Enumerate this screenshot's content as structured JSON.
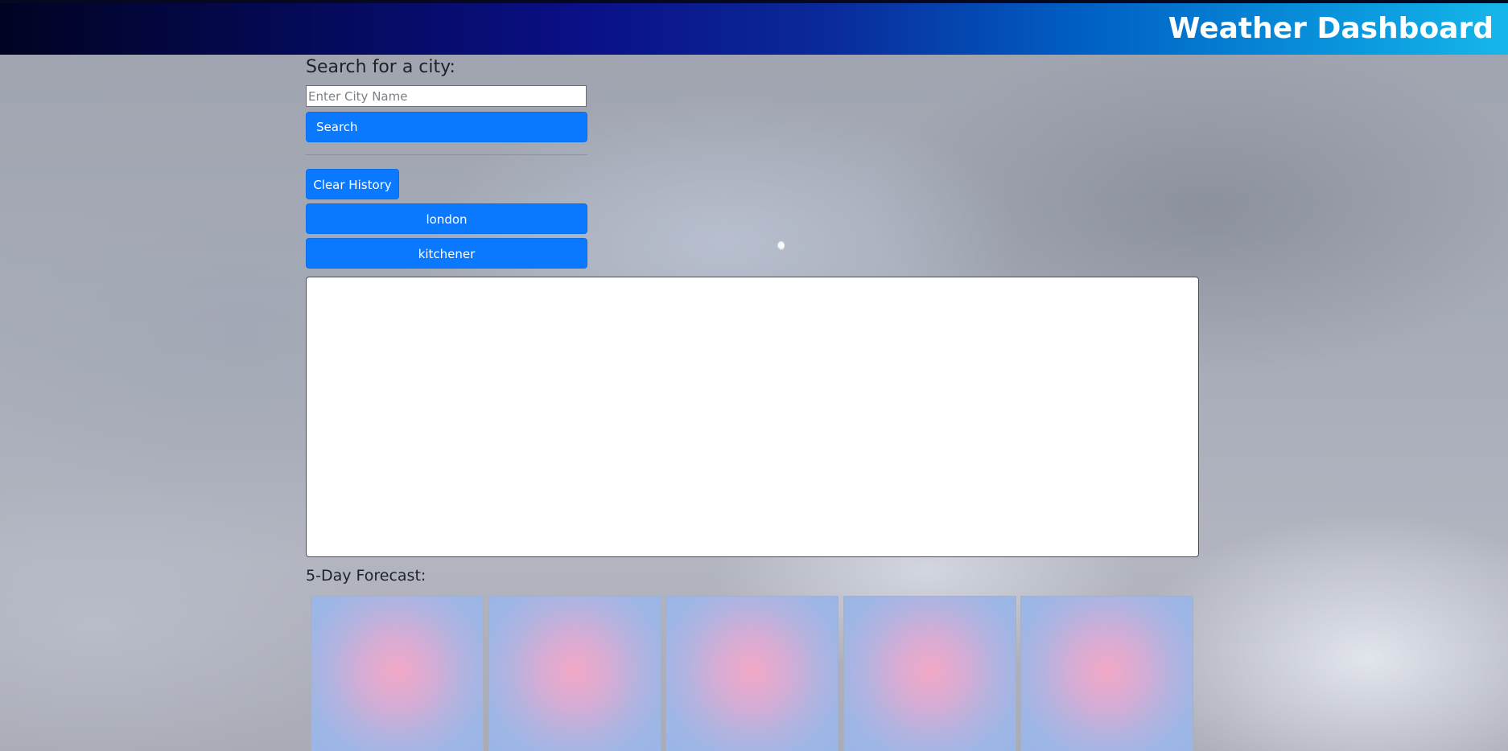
{
  "header": {
    "title": "Weather Dashboard"
  },
  "search": {
    "label": "Search for a city:",
    "placeholder": "Enter City Name",
    "value": "",
    "button_label": "Search"
  },
  "history": {
    "clear_label": "Clear History",
    "items": [
      {
        "label": "london"
      },
      {
        "label": "kitchener"
      }
    ]
  },
  "forecast": {
    "label": "5-Day Forecast:",
    "cards": [
      {},
      {},
      {},
      {},
      {}
    ]
  },
  "colors": {
    "button": "#0a79ff",
    "header_start": "#010322",
    "header_end": "#16b7ea",
    "card_center": "#f2a8c6",
    "card_edge": "#9ab6e6"
  }
}
